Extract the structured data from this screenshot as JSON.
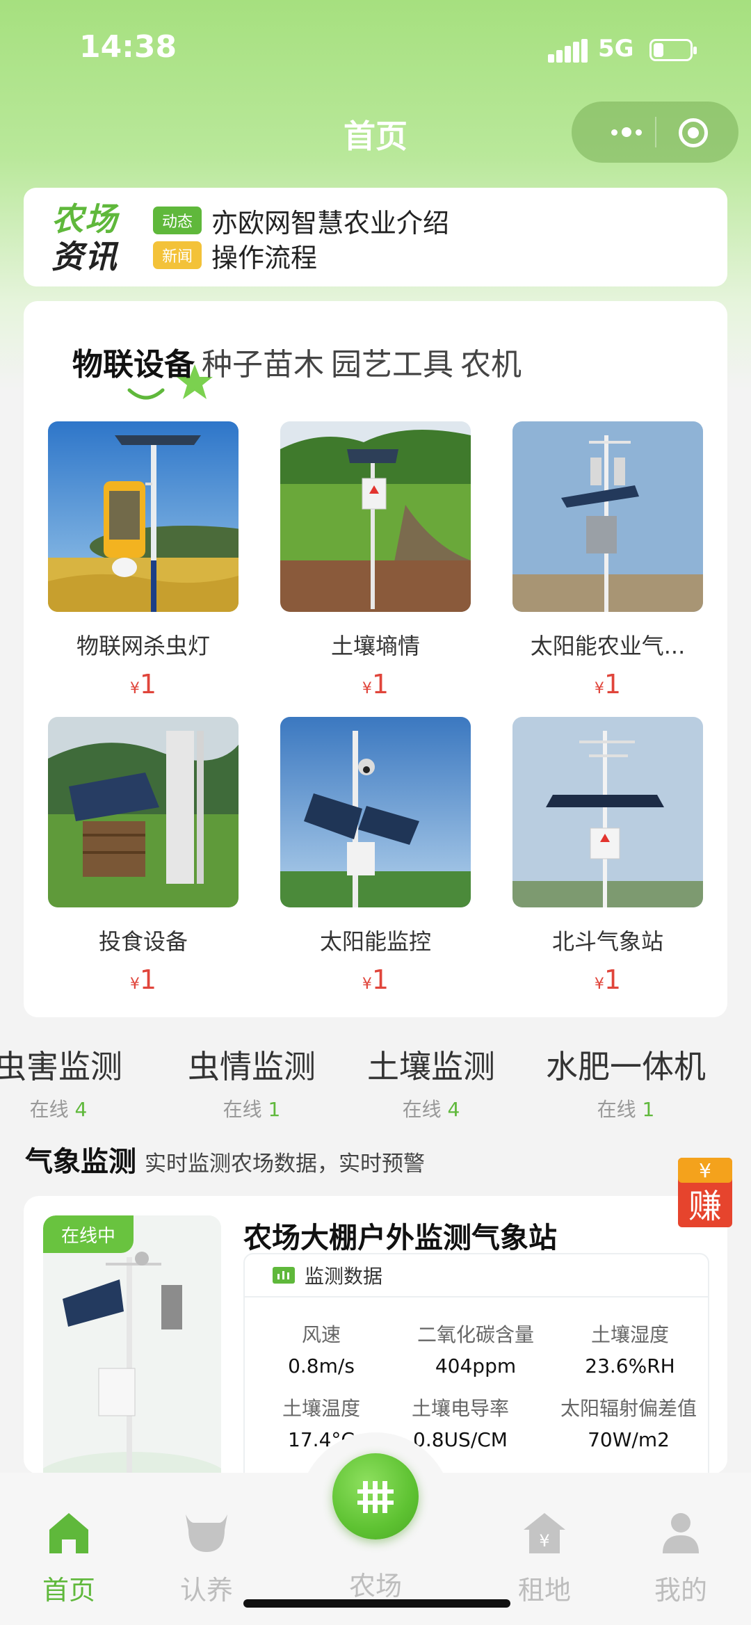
{
  "status_bar": {
    "time": "14:38",
    "network": "5G"
  },
  "nav": {
    "title": "首页",
    "more_icon": "more-dots-icon",
    "close_icon": "target-icon"
  },
  "news": {
    "logo_line1": "农场",
    "logo_line2": "资讯",
    "items": [
      {
        "tag": "动态",
        "tag_color": "#5fb83b",
        "text": "亦欧网智慧农业介绍"
      },
      {
        "tag": "新闻",
        "tag_color": "#f3c239",
        "text": "操作流程"
      }
    ]
  },
  "category_tabs": [
    {
      "label": "物联设备",
      "active": true
    },
    {
      "label": "种子苗木",
      "active": false
    },
    {
      "label": "园艺工具",
      "active": false
    },
    {
      "label": "农机",
      "active": false
    }
  ],
  "products": [
    {
      "name": "物联网杀虫灯",
      "currency": "¥",
      "price": "1"
    },
    {
      "name": "土壤墒情",
      "currency": "¥",
      "price": "1"
    },
    {
      "name": "太阳能农业气...",
      "currency": "¥",
      "price": "1"
    },
    {
      "name": "投食设备",
      "currency": "¥",
      "price": "1"
    },
    {
      "name": "太阳能监控",
      "currency": "¥",
      "price": "1"
    },
    {
      "name": "北斗气象站",
      "currency": "¥",
      "price": "1"
    }
  ],
  "monitor_categories": [
    {
      "title": "虫害监测",
      "online_label": "在线",
      "count": "4"
    },
    {
      "title": "虫情监测",
      "online_label": "在线",
      "count": "1"
    },
    {
      "title": "土壤监测",
      "online_label": "在线",
      "count": "4"
    },
    {
      "title": "水肥一体机",
      "online_label": "在线",
      "count": "1"
    }
  ],
  "weather": {
    "title": "气象监测",
    "subtitle": "实时监测农场数据，实时预警",
    "earn_symbol": "¥",
    "earn_label": "赚"
  },
  "station": {
    "status": "在线中",
    "name": "农场大棚户外监测气象站",
    "data_header": "监测数据",
    "metrics": [
      {
        "label": "风速",
        "value": "0.8m/s"
      },
      {
        "label": "二氧化碳含量",
        "value": "404ppm"
      },
      {
        "label": "土壤湿度",
        "value": "23.6%RH"
      },
      {
        "label": "土壤温度",
        "value": "17.4°C"
      },
      {
        "label": "土壤电导率",
        "value": "0.8US/CM"
      },
      {
        "label": "太阳辐射偏差值",
        "value": "70W/m2"
      }
    ]
  },
  "tabbar": {
    "items": [
      {
        "label": "首页",
        "icon": "home-icon",
        "active": true
      },
      {
        "label": "认养",
        "icon": "cow-icon",
        "active": false
      },
      {
        "label": "农场",
        "icon": "farm-fence-icon",
        "active": false
      },
      {
        "label": "租地",
        "icon": "rent-land-icon",
        "active": false
      },
      {
        "label": "我的",
        "icon": "profile-icon",
        "active": false
      }
    ]
  },
  "colors": {
    "brand_green": "#5fb83b",
    "price_red": "#e0453b",
    "header_green": "#a6e07f"
  }
}
